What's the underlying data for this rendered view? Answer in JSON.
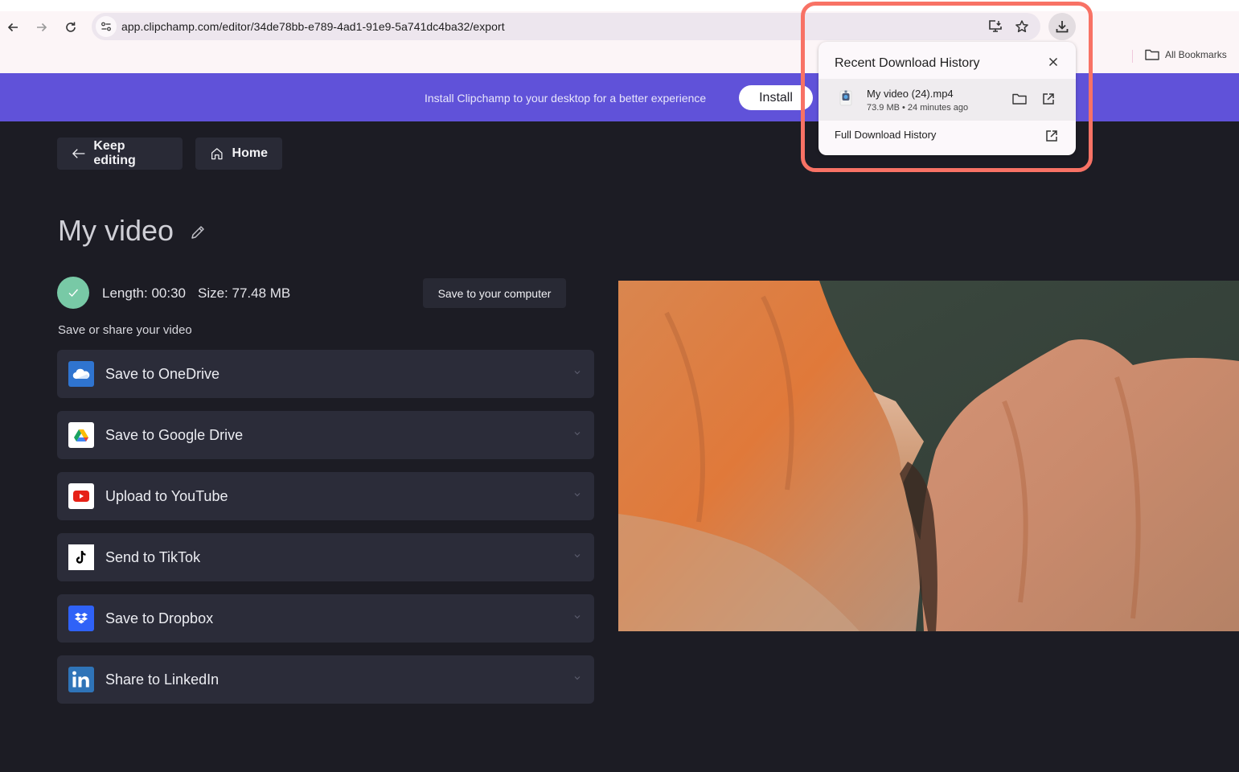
{
  "browser": {
    "url": "app.clipchamp.com/editor/34de78bb-e789-4ad1-91e9-5a741dc4ba32/export",
    "bookmarks_label": "All Bookmarks",
    "icons": {
      "back": "arrow-left-icon",
      "forward": "arrow-right-icon",
      "reload": "reload-icon",
      "site_info": "tune-icon",
      "install_app": "install-desktop-icon",
      "bookmark": "star-icon",
      "downloads": "download-icon"
    }
  },
  "banner": {
    "text": "Install Clipchamp to your desktop for a better experience",
    "install_label": "Install",
    "color": "#6052d9"
  },
  "nav": {
    "keep_editing_label": "Keep editing",
    "home_label": "Home"
  },
  "export": {
    "title": "My video",
    "length_text": "Length: 00:30",
    "size_text": "Size: 77.48 MB",
    "save_computer_label": "Save to your computer",
    "share_heading": "Save or share your video",
    "status": "complete",
    "status_color": "#78c9a6",
    "share_options": [
      {
        "label": "Save to OneDrive",
        "icon": "onedrive-icon"
      },
      {
        "label": "Save to Google Drive",
        "icon": "google-drive-icon"
      },
      {
        "label": "Upload to YouTube",
        "icon": "youtube-icon"
      },
      {
        "label": "Send to TikTok",
        "icon": "tiktok-icon"
      },
      {
        "label": "Save to Dropbox",
        "icon": "dropbox-icon"
      },
      {
        "label": "Share to LinkedIn",
        "icon": "linkedin-icon"
      }
    ]
  },
  "preview": {
    "description": "Aerial view of orange eroded sandstone cliffs by the sea"
  },
  "download_popup": {
    "title": "Recent Download History",
    "item": {
      "filename": "My video (24).mp4",
      "meta": "73.9 MB • 24 minutes ago"
    },
    "full_history_label": "Full Download History",
    "highlight_color": "#f87265"
  }
}
